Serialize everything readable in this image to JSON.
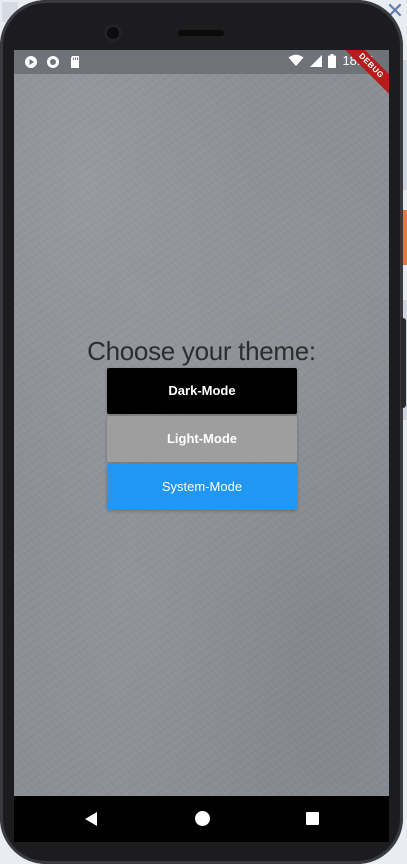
{
  "status_bar": {
    "time": "18:41",
    "left_icons": [
      "play-circle-icon",
      "record-circle-icon",
      "sd-card-icon"
    ],
    "right_icons": [
      "wifi-icon",
      "cell-signal-icon",
      "battery-icon"
    ]
  },
  "debug_banner": "DEBUG",
  "main": {
    "title": "Choose your theme:",
    "buttons": [
      {
        "label": "Dark-Mode",
        "color": "#000000"
      },
      {
        "label": "Light-Mode",
        "color": "#9e9e9e"
      },
      {
        "label": "System-Mode",
        "color": "#2196f3"
      }
    ]
  },
  "nav_bar": {
    "icons": [
      "back-icon",
      "home-icon",
      "recent-apps-icon"
    ]
  },
  "colors": {
    "background": "#8b8e95",
    "status_bar": "#6f7279",
    "debug_banner": "#b71c1c"
  }
}
